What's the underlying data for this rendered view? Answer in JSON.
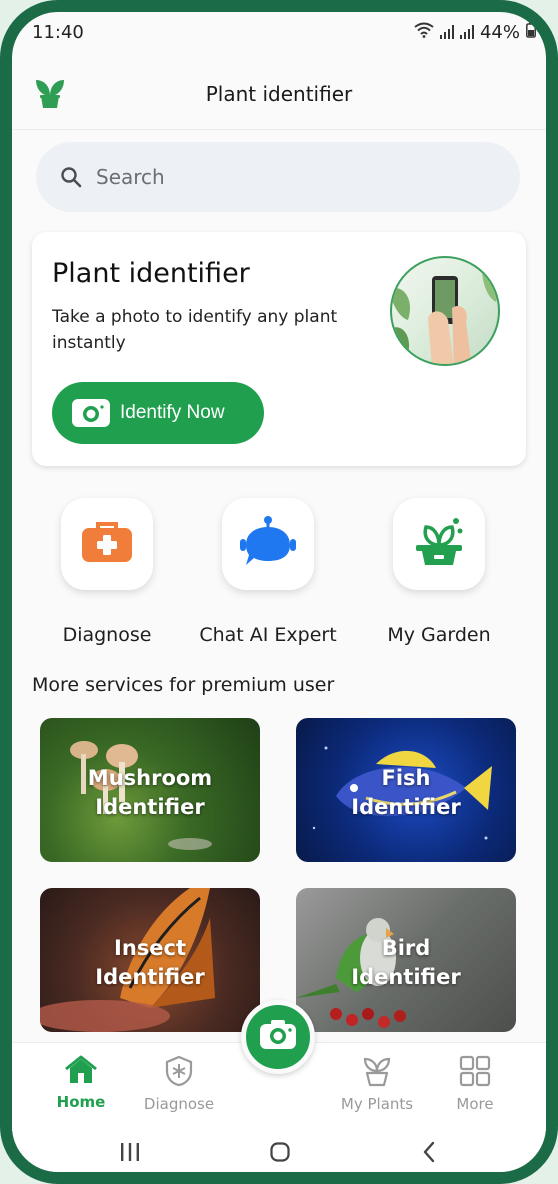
{
  "status_bar": {
    "time": "11:40",
    "battery": "44%"
  },
  "header": {
    "title": "Plant identifier"
  },
  "search": {
    "placeholder": "Search"
  },
  "hero": {
    "title": "Plant identifier",
    "description": "Take a photo to identify any plant instantly",
    "button_label": "Identify Now"
  },
  "quick_actions": [
    {
      "label": "Diagnose",
      "icon": "first-aid-kit-icon"
    },
    {
      "label": "Chat AI Expert",
      "icon": "robot-chat-icon"
    },
    {
      "label": "My Garden",
      "icon": "plant-pot-icon"
    }
  ],
  "services": {
    "title": "More services for premium user",
    "items": [
      {
        "label": "Mushroom\nIdentifier"
      },
      {
        "label": "Fish\nIdentifier"
      },
      {
        "label": "Insect\nIdentifier"
      },
      {
        "label": "Bird\nIdentifier"
      }
    ]
  },
  "bottom_nav": [
    {
      "label": "Home",
      "icon": "home-icon",
      "active": true
    },
    {
      "label": "Diagnose",
      "icon": "diagnose-shield-icon",
      "active": false
    },
    {
      "label": "My Plants",
      "icon": "plant-icon",
      "active": false
    },
    {
      "label": "More",
      "icon": "grid-icon",
      "active": false
    }
  ],
  "colors": {
    "accent": "#20a04f",
    "frame": "#1c6b47",
    "inactive": "#9a9a9a"
  }
}
